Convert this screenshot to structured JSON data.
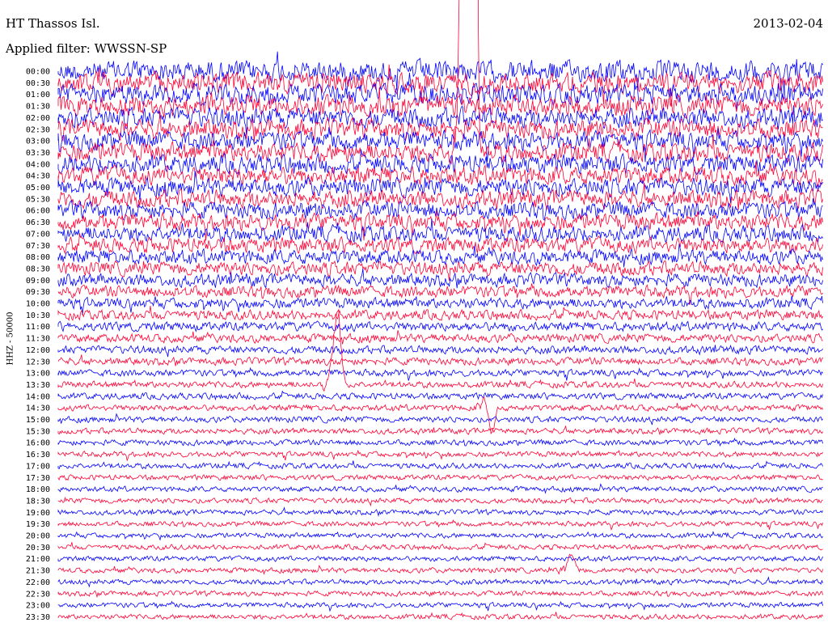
{
  "header": {
    "station": "HT Thassos Isl.",
    "date": "2013-02-04",
    "filter": "Applied filter: WWSSN-SP"
  },
  "chart_data": {
    "type": "line",
    "title": "HT Thassos Isl.",
    "channel_label": "HHZ - 50000",
    "row_labels": [
      "00:00",
      "00:30",
      "01:00",
      "01:30",
      "02:00",
      "02:30",
      "03:00",
      "03:30",
      "04:00",
      "04:30",
      "05:00",
      "05:30",
      "06:00",
      "06:30",
      "07:00",
      "07:30",
      "08:00",
      "08:30",
      "09:00",
      "09:30",
      "10:00",
      "10:30",
      "11:00",
      "11:30",
      "12:00",
      "12:30",
      "13:00",
      "13:30",
      "14:00",
      "14:30",
      "15:00",
      "15:30",
      "16:00",
      "16:30",
      "17:00",
      "17:30",
      "18:00",
      "18:30",
      "19:00",
      "19:30",
      "20:00",
      "20:30",
      "21:00",
      "21:30",
      "22:00",
      "22:30",
      "23:00",
      "23:30"
    ],
    "series_colors": [
      "#0000ff",
      "#ff0033"
    ],
    "relative_amplitude": [
      1.0,
      0.98,
      0.96,
      0.94,
      0.93,
      0.92,
      0.9,
      0.9,
      0.88,
      0.86,
      0.84,
      0.82,
      0.8,
      0.78,
      0.75,
      0.72,
      0.68,
      0.64,
      0.6,
      0.55,
      0.5,
      0.46,
      0.43,
      0.4,
      0.37,
      0.35,
      0.32,
      0.3,
      0.3,
      0.29,
      0.28,
      0.27,
      0.27,
      0.26,
      0.26,
      0.25,
      0.25,
      0.25,
      0.24,
      0.24,
      0.24,
      0.24,
      0.24,
      0.24,
      0.24,
      0.24,
      0.24,
      0.24
    ],
    "events": [
      {
        "time": "03:30",
        "amplitude": 1.8
      },
      {
        "time": "13:30",
        "amplitude": 1.2
      },
      {
        "time": "14:30",
        "amplitude": 1.0
      },
      {
        "time": "21:30",
        "amplitude": 0.7
      }
    ]
  }
}
